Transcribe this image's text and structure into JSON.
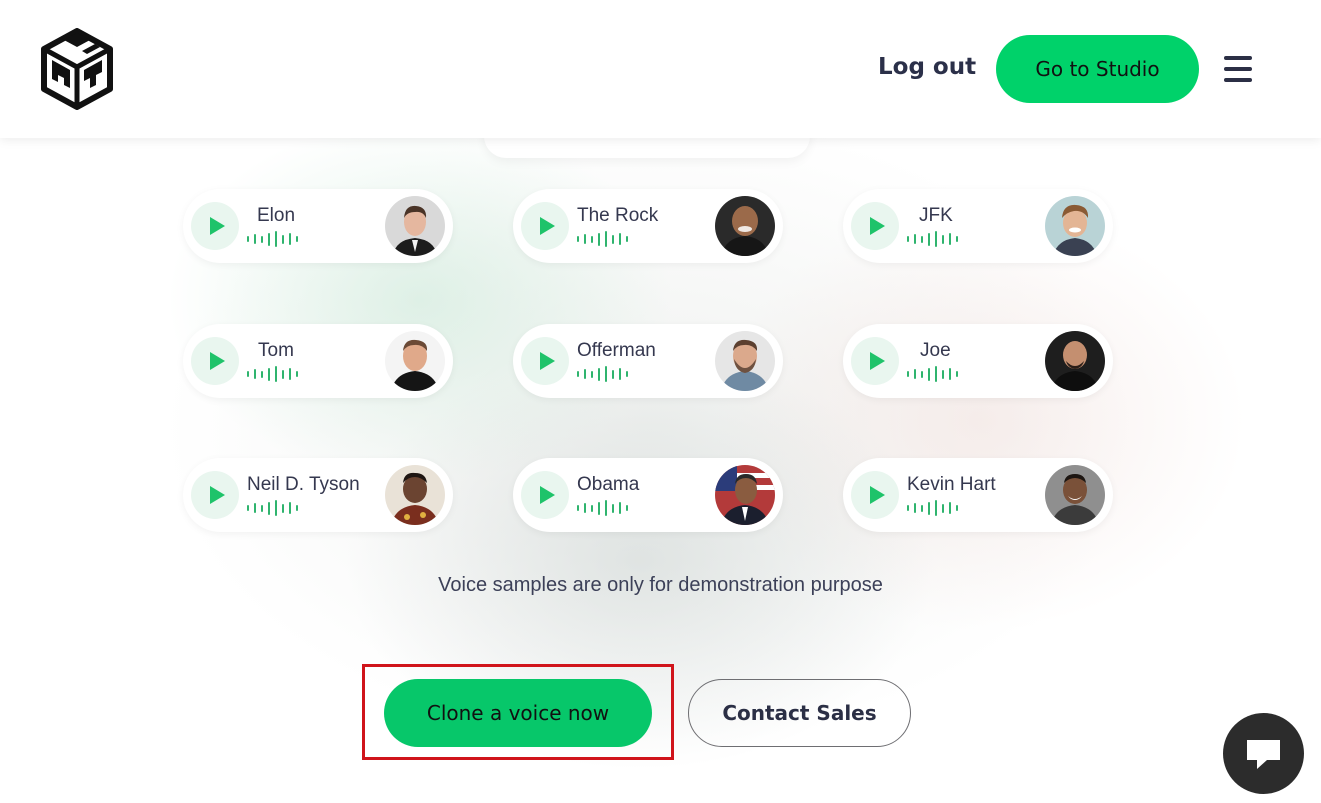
{
  "header": {
    "logo_icon": "cube-logo-icon",
    "logout_label": "Log out",
    "studio_label": "Go to Studio",
    "menu_icon": "hamburger-menu-icon"
  },
  "voices": [
    {
      "name": "Elon"
    },
    {
      "name": "The Rock"
    },
    {
      "name": "JFK"
    },
    {
      "name": "Tom"
    },
    {
      "name": "Offerman"
    },
    {
      "name": "Joe"
    },
    {
      "name": "Neil D. Tyson"
    },
    {
      "name": "Obama"
    },
    {
      "name": "Kevin Hart"
    }
  ],
  "disclaimer": "Voice samples are only for demonstration purpose",
  "cta": {
    "clone_label": "Clone a voice now",
    "contact_label": "Contact Sales"
  },
  "chat_icon": "chat-bubble-icon",
  "colors": {
    "accent": "#00d26a",
    "play_icon": "#1fc36a",
    "highlight_box": "#d0141b",
    "text_dark": "#2b3049"
  }
}
